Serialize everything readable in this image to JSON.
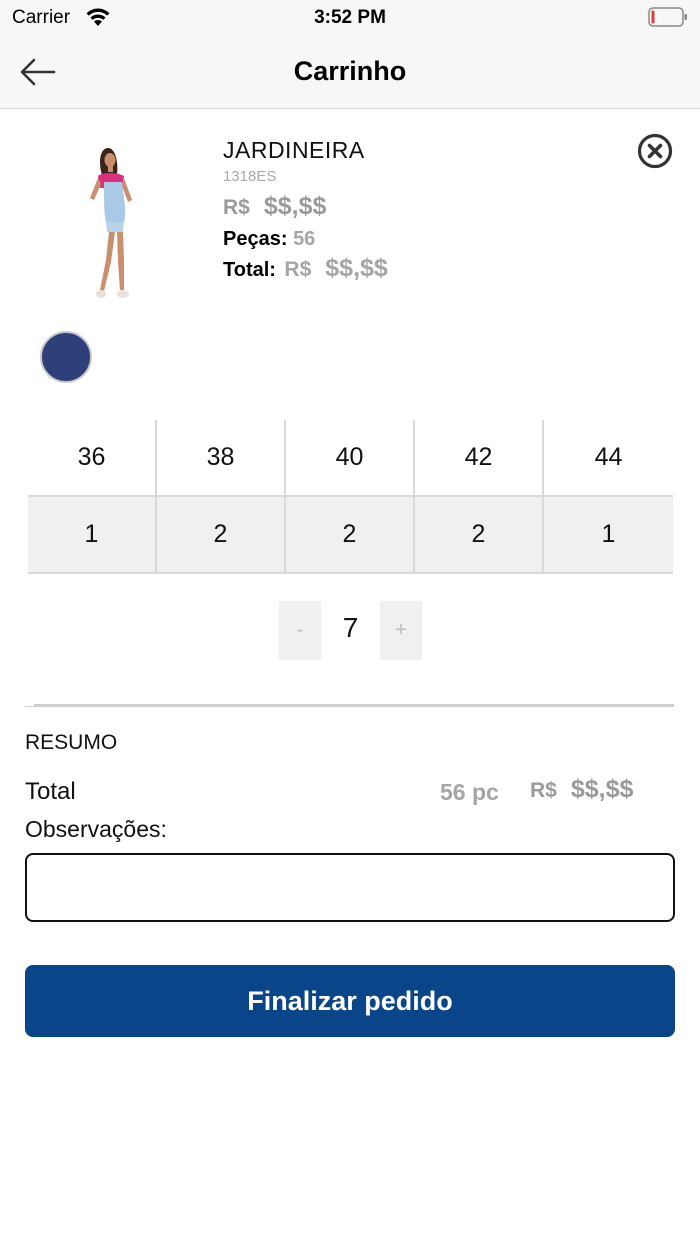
{
  "status_bar": {
    "carrier": "Carrier",
    "time": "3:52 PM"
  },
  "header": {
    "title": "Carrinho",
    "back_icon": "arrow-left-icon"
  },
  "item": {
    "name": "JARDINEIRA",
    "code": "1318ES",
    "price_currency": "R$",
    "price_value": "$$,$$",
    "pieces_label": "Peças:",
    "pieces_value": "56",
    "total_label": "Total:",
    "total_currency": "R$",
    "total_value": "$$,$$",
    "remove_icon": "close-circle-icon",
    "color_swatch": "#2f3f7a"
  },
  "sizes": [
    {
      "size": "36",
      "qty": "1"
    },
    {
      "size": "38",
      "qty": "2"
    },
    {
      "size": "40",
      "qty": "2"
    },
    {
      "size": "42",
      "qty": "2"
    },
    {
      "size": "44",
      "qty": "1"
    }
  ],
  "stepper": {
    "minus": "-",
    "value": "7",
    "plus": "+"
  },
  "summary": {
    "title": "RESUMO",
    "total_label": "Total",
    "pieces": "56 pc",
    "currency": "R$",
    "amount": "$$,$$",
    "observations_label": "Observações:",
    "observations_value": ""
  },
  "checkout_button": "Finalizar pedido",
  "colors": {
    "primary": "#0a4589",
    "muted": "#9a9a9a",
    "cell_bg": "#f0f0f0"
  }
}
